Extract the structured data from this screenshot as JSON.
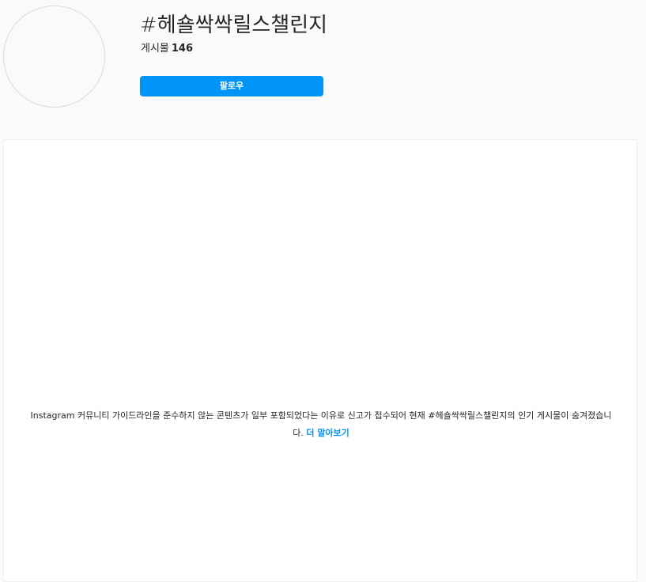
{
  "hashtag": {
    "title": "#헤숄싹싹릴스챌린지",
    "posts_label": "게시물",
    "posts_count": "146"
  },
  "actions": {
    "follow_label": "팔로우"
  },
  "notice": {
    "text": "Instagram 커뮤니티 가이드라인을 준수하지 않는 콘텐츠가 일부 포함되었다는 이유로 신고가 접수되어 현재 #헤숄싹싹릴스챌린지의 인기 게시물이 숨겨졌습니다.",
    "link_label": "더 알아보기"
  },
  "colors": {
    "accent": "#0095f6",
    "background": "#fafafa",
    "panel": "#ffffff",
    "text": "#262626"
  }
}
